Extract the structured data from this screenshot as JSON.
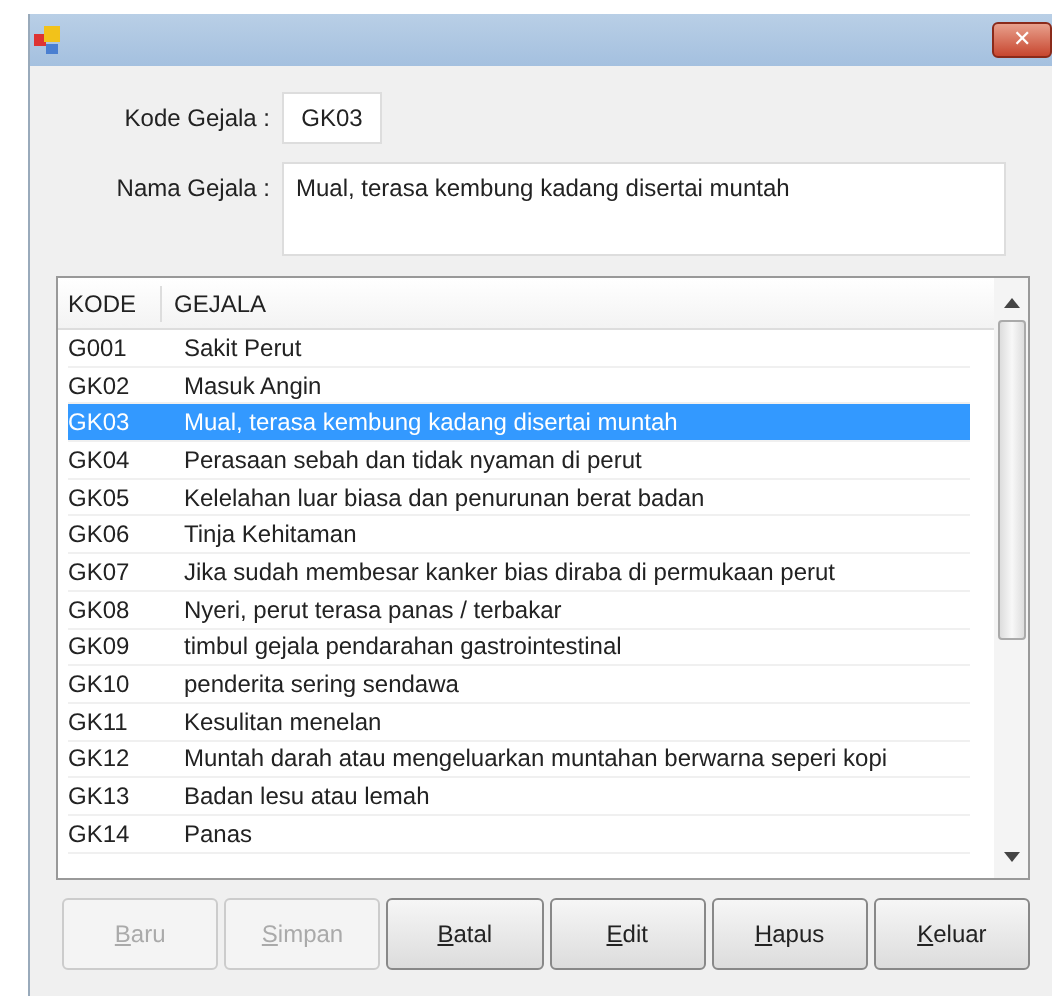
{
  "window": {
    "close": "✕"
  },
  "form": {
    "kode_label": "Kode Gejala :",
    "kode_value": "GK03",
    "nama_label": "Nama Gejala :",
    "nama_value": "Mual, terasa kembung kadang disertai muntah"
  },
  "table": {
    "columns": [
      "KODE",
      "GEJALA"
    ],
    "rows": [
      {
        "kode": "G001",
        "gejala": "Sakit Perut",
        "selected": false
      },
      {
        "kode": "GK02",
        "gejala": "Masuk Angin",
        "selected": false
      },
      {
        "kode": "GK03",
        "gejala": "Mual, terasa kembung kadang disertai muntah",
        "selected": true
      },
      {
        "kode": "GK04",
        "gejala": "Perasaan sebah dan tidak nyaman di perut",
        "selected": false
      },
      {
        "kode": "GK05",
        "gejala": "Kelelahan luar biasa dan penurunan berat badan",
        "selected": false
      },
      {
        "kode": "GK06",
        "gejala": "Tinja Kehitaman",
        "selected": false
      },
      {
        "kode": "GK07",
        "gejala": "Jika sudah membesar kanker bias diraba di permukaan perut",
        "selected": false
      },
      {
        "kode": "GK08",
        "gejala": "Nyeri, perut terasa panas / terbakar",
        "selected": false
      },
      {
        "kode": "GK09",
        "gejala": "timbul gejala pendarahan gastrointestinal",
        "selected": false
      },
      {
        "kode": "GK10",
        "gejala": "penderita sering sendawa",
        "selected": false
      },
      {
        "kode": "GK11",
        "gejala": "Kesulitan menelan",
        "selected": false
      },
      {
        "kode": "GK12",
        "gejala": "Muntah darah atau mengeluarkan muntahan berwarna seperi kopi",
        "selected": false
      },
      {
        "kode": "GK13",
        "gejala": "Badan lesu atau lemah",
        "selected": false
      },
      {
        "kode": "GK14",
        "gejala": "Panas",
        "selected": false
      }
    ]
  },
  "buttons": [
    {
      "label": "Baru",
      "disabled": true
    },
    {
      "label": "Simpan",
      "disabled": true
    },
    {
      "label": "Batal",
      "disabled": false
    },
    {
      "label": "Edit",
      "disabled": false
    },
    {
      "label": "Hapus",
      "disabled": false
    },
    {
      "label": "Keluar",
      "disabled": false
    }
  ]
}
